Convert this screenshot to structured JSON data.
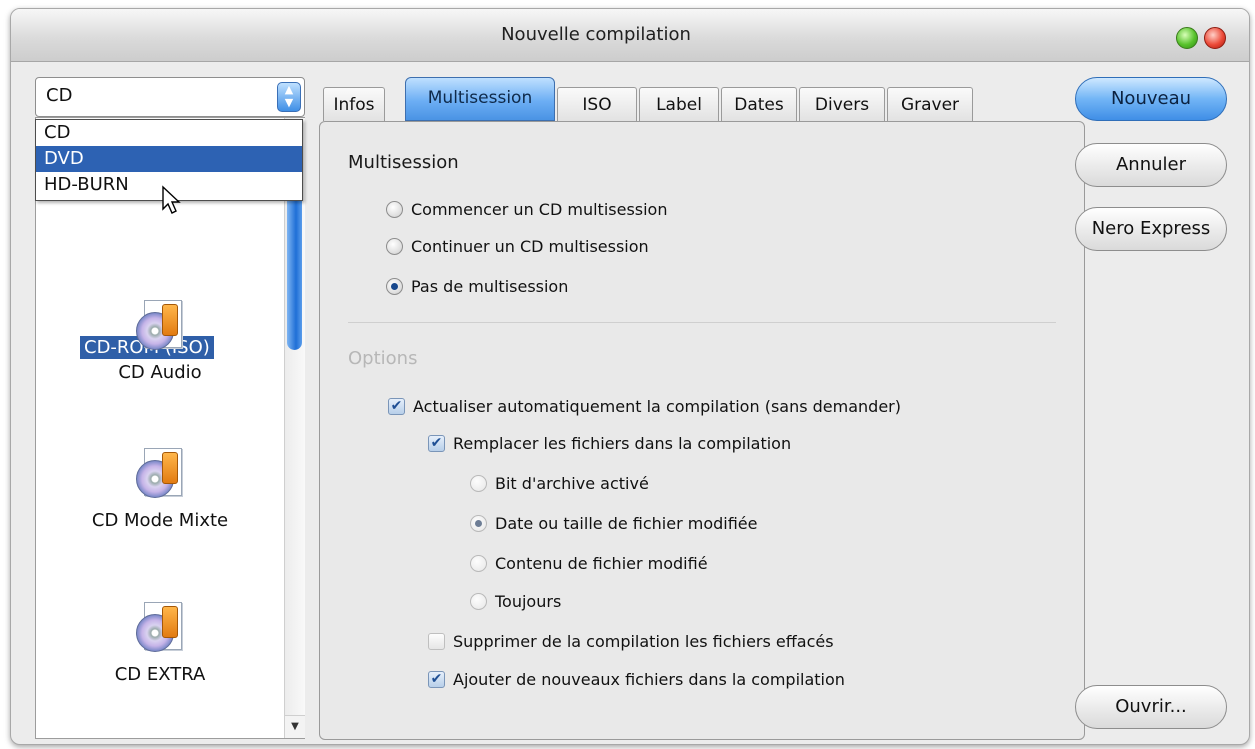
{
  "window": {
    "title": "Nouvelle compilation"
  },
  "left": {
    "select_value": "CD",
    "dropdown_options": [
      "CD",
      "DVD",
      "HD-BURN"
    ],
    "selected_option": "DVD",
    "items": [
      {
        "label": "CD-ROM (ISO)",
        "icon": "cd-rom-iso-icon"
      },
      {
        "label": "CD Audio",
        "icon": "cd-audio-icon"
      },
      {
        "label": "CD Mode Mixte",
        "icon": "cd-mixed-mode-icon"
      },
      {
        "label": "CD EXTRA",
        "icon": "cd-extra-icon"
      }
    ]
  },
  "tabs": [
    "Infos",
    "Multisession",
    "ISO",
    "Label",
    "Dates",
    "Divers",
    "Graver"
  ],
  "active_tab": "Multisession",
  "multisession": {
    "heading": "Multisession",
    "options": [
      "Commencer un CD multisession",
      "Continuer un CD multisession",
      "Pas de multisession"
    ],
    "selected": "Pas de multisession"
  },
  "options": {
    "heading": "Options",
    "auto_update": "Actualiser automatiquement la compilation (sans demander)",
    "replace_files": "Remplacer les fichiers dans la compilation",
    "replace_choices": [
      "Bit d'archive activé",
      "Date ou taille de fichier modifiée",
      "Contenu de fichier modifié",
      "Toujours"
    ],
    "replace_selected": "Date ou taille de fichier modifiée",
    "delete_removed": "Supprimer de la compilation les fichiers effacés",
    "add_new": "Ajouter de nouveaux fichiers dans la compilation"
  },
  "buttons": {
    "nouveau": "Nouveau",
    "annuler": "Annuler",
    "nero_express": "Nero Express",
    "ouvrir": "Ouvrir..."
  },
  "colors": {
    "accent": "#3f8ee6",
    "selection": "#2d62b3"
  }
}
